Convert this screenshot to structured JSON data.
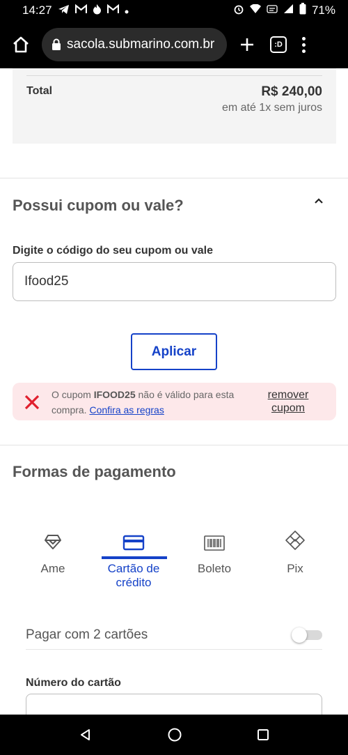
{
  "status_bar": {
    "time": "14:27",
    "battery": "71%",
    "left_icons": [
      "telegram-icon",
      "gmail-icon",
      "fire-icon",
      "gmail-icon",
      "dot-icon"
    ],
    "right_icons": [
      "alarm-icon",
      "wifi-icon",
      "volte-icon",
      "signal-icon",
      "battery-icon"
    ]
  },
  "browser": {
    "url": "sacola.submarino.com.br",
    "tabs_count": ":D"
  },
  "summary": {
    "total_label": "Total",
    "total_value": "R$ 240,00",
    "installments": "em até 1x sem juros"
  },
  "coupon": {
    "title": "Possui cupom ou vale?",
    "field_label": "Digite o código do seu cupom ou vale",
    "value": "Ifood25",
    "apply_label": "Aplicar",
    "error": {
      "prefix": "O cupom ",
      "code": "IFOOD25",
      "suffix": " não é válido para esta compra. ",
      "rules_link": "Confira as regras",
      "remove_label": "remover cupom"
    }
  },
  "payment": {
    "title": "Formas de pagamento",
    "methods": [
      {
        "label": "Ame",
        "icon": "ame-icon",
        "active": false
      },
      {
        "label": "Cartão de crédito",
        "icon": "credit-card-icon",
        "active": true
      },
      {
        "label": "Boleto",
        "icon": "barcode-icon",
        "active": false
      },
      {
        "label": "Pix",
        "icon": "pix-icon",
        "active": false
      }
    ],
    "two_cards_label": "Pagar com 2 cartões",
    "two_cards_enabled": false,
    "card_number_label": "Número do cartão",
    "card_number_value": ""
  },
  "colors": {
    "accent": "#1542c8",
    "error_bg": "#fde8ea",
    "error_icon": "#e0202e"
  }
}
